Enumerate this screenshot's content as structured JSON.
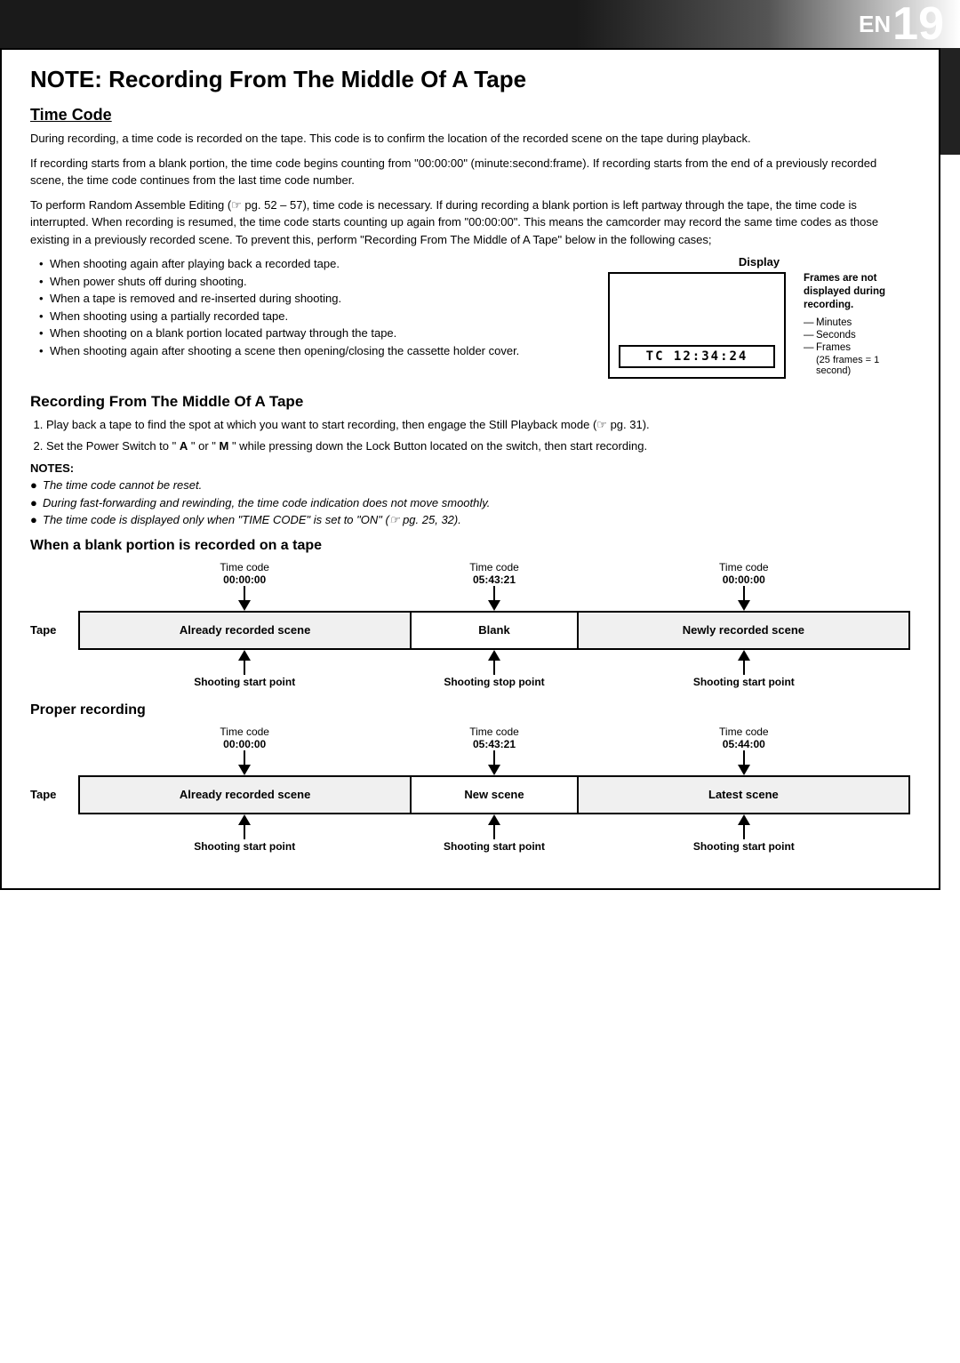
{
  "header": {
    "en_prefix": "EN",
    "page_number": "19"
  },
  "page_title": "NOTE: Recording From The Middle Of A Tape",
  "sections": {
    "time_code": {
      "title": "Time Code",
      "para1": "During recording, a time code is recorded on the tape. This code is to confirm the location of the recorded scene on the tape during playback.",
      "para2": "If recording starts from a blank portion, the time code begins counting from \"00:00:00\" (minute:second:frame). If recording starts from the end of a previously recorded scene, the time code continues from the last time code number.",
      "para3": "To perform Random Assemble Editing (☞ pg. 52 – 57), time code is necessary. If during recording a blank portion is left partway through the tape, the time code is interrupted. When recording is resumed, the time code starts counting up again from \"00:00:00\". This means the camcorder may record the same time codes as those existing in a previously recorded scene. To prevent this, perform \"Recording From The Middle of A Tape\" below in the following cases;",
      "bullets": [
        "When shooting again after playing back a recorded tape.",
        "When power shuts off during shooting.",
        "When a tape is removed and re-inserted during shooting.",
        "When shooting using a partially recorded tape.",
        "When shooting on a blank portion located partway through the tape.",
        "When shooting again after shooting a scene then opening/closing the cassette holder cover."
      ],
      "display_diagram": {
        "label": "Display",
        "frames_not_displayed": "Frames are not displayed during recording.",
        "annotations": [
          "Minutes",
          "Seconds",
          "Frames"
        ],
        "frames_note": "(25 frames = 1 second)",
        "tc_code": "TC 12:34:24"
      }
    },
    "recording_middle": {
      "title": "Recording From The Middle Of A Tape",
      "steps": [
        "Play back a tape to find the spot at which you want to start recording, then engage the Still Playback mode (☞ pg. 31).",
        "Set the Power Switch to \" \" or \" \" while pressing down the Lock Button located on the switch, then start recording."
      ]
    },
    "notes": {
      "title": "NOTES:",
      "items": [
        "The time code cannot be reset.",
        "During fast-forwarding and rewinding, the time code indication does not move smoothly.",
        "The time code is displayed only when \"TIME CODE\" is set to \"ON\" (☞ pg. 25, 32)."
      ]
    },
    "blank_portion": {
      "title": "When a blank portion is recorded on a tape",
      "tc_labels": [
        "Time code",
        "Time code",
        "Time code"
      ],
      "tc_values": [
        "00:00:00",
        "05:43:21",
        "00:00:00"
      ],
      "tape_label": "Tape",
      "segments": [
        "Already recorded scene",
        "Blank",
        "Newly recorded scene"
      ],
      "shoot_labels": [
        "Shooting start point",
        "Shooting stop point",
        "Shooting start point"
      ]
    },
    "proper_recording": {
      "title": "Proper recording",
      "tc_labels": [
        "Time code",
        "Time code",
        "Time code"
      ],
      "tc_values": [
        "00:00:00",
        "05:43:21",
        "05:44:00"
      ],
      "tape_label": "Tape",
      "segments": [
        "Already recorded scene",
        "New scene",
        "Latest scene"
      ],
      "shoot_labels": [
        "Shooting start point",
        "Shooting start point",
        "Shooting start point"
      ]
    }
  }
}
